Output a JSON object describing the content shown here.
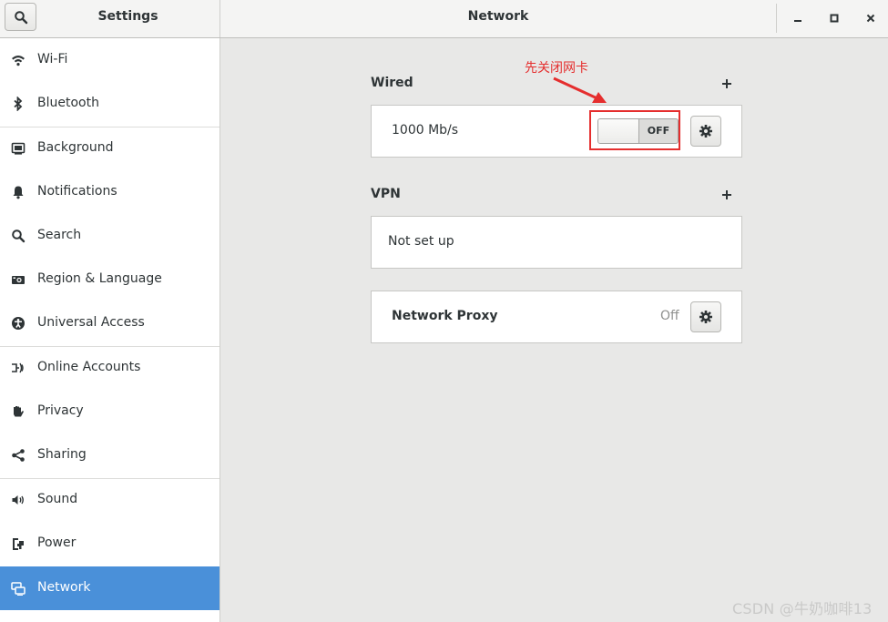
{
  "header": {
    "app_title": "Settings",
    "page_title": "Network",
    "search_icon": "search-icon",
    "window_controls": [
      "minimize-icon",
      "maximize-icon",
      "close-icon"
    ]
  },
  "sidebar": {
    "items": [
      {
        "label": "Wi-Fi",
        "icon": "wifi-icon"
      },
      {
        "label": "Bluetooth",
        "icon": "bluetooth-icon"
      },
      {
        "label": "Background",
        "icon": "background-icon"
      },
      {
        "label": "Notifications",
        "icon": "bell-icon"
      },
      {
        "label": "Search",
        "icon": "search-icon"
      },
      {
        "label": "Region & Language",
        "icon": "camera-icon"
      },
      {
        "label": "Universal Access",
        "icon": "accessibility-icon"
      },
      {
        "label": "Online Accounts",
        "icon": "online-accounts-icon"
      },
      {
        "label": "Privacy",
        "icon": "hand-icon"
      },
      {
        "label": "Sharing",
        "icon": "share-icon"
      },
      {
        "label": "Sound",
        "icon": "speaker-icon"
      },
      {
        "label": "Power",
        "icon": "power-icon"
      },
      {
        "label": "Network",
        "icon": "network-icon",
        "selected": true
      }
    ]
  },
  "main": {
    "wired": {
      "title": "Wired",
      "speed": "1000 Mb/s",
      "switch_state": "OFF"
    },
    "vpn": {
      "title": "VPN",
      "status": "Not set up"
    },
    "proxy": {
      "title": "Network Proxy",
      "status": "Off"
    }
  },
  "annotation": {
    "text": "先关闭网卡",
    "color": "#e52e2e"
  },
  "watermark": "CSDN @牛奶咖啡13",
  "colors": {
    "accent": "#4a90d9",
    "background": "#e8e8e7",
    "annotation": "#e52e2e"
  }
}
